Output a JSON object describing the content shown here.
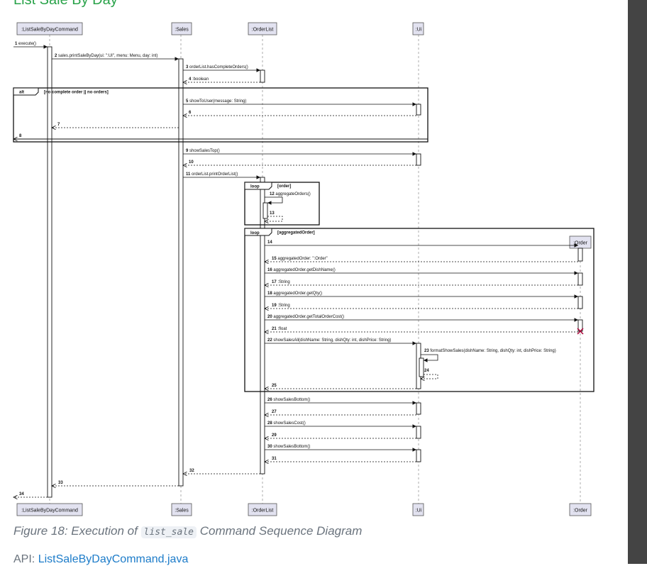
{
  "heading": "List Sale By Day",
  "participants": {
    "listSaleByDayCommand": ":ListSaleByDayCommand",
    "sales": ":Sales",
    "orderList": ":OrderList",
    "ui": ":Ui",
    "order": ":Order"
  },
  "fragments": {
    "alt_label": "alt",
    "alt_guard": "[no complete order || no orders]",
    "loop1_label": "loop",
    "loop1_guard": "[order]",
    "loop2_label": "loop",
    "loop2_guard": "[aggregatedOrder]"
  },
  "messages": [
    {
      "num": "1",
      "text": "execute()"
    },
    {
      "num": "2",
      "text": "sales.printSaleByDay(ui: \":UI\", menu: Menu, day: int)"
    },
    {
      "num": "3",
      "text": "orderList.hasCompleteOrders()"
    },
    {
      "num": "4",
      "text": ":boolean"
    },
    {
      "num": "5",
      "text": "showToUser(message: String)"
    },
    {
      "num": "6",
      "text": ""
    },
    {
      "num": "7",
      "text": ""
    },
    {
      "num": "8",
      "text": ""
    },
    {
      "num": "9",
      "text": "showSalesTop()"
    },
    {
      "num": "10",
      "text": ""
    },
    {
      "num": "11",
      "text": "orderList.printOrderList()"
    },
    {
      "num": "12",
      "text": "aggregateOrders()"
    },
    {
      "num": "13",
      "text": ""
    },
    {
      "num": "14",
      "text": ""
    },
    {
      "num": "15",
      "text": "aggregatedOrder: \":Order\""
    },
    {
      "num": "16",
      "text": "aggregatedOrder.getDishName()"
    },
    {
      "num": "17",
      "text": ":String"
    },
    {
      "num": "18",
      "text": "aggregatedOrder.getQty()"
    },
    {
      "num": "19",
      "text": ":String"
    },
    {
      "num": "20",
      "text": "aggregatedOrder.getTotalOrderCost()"
    },
    {
      "num": "21",
      "text": ":float"
    },
    {
      "num": "22",
      "text": "showSalesAll(dishName: String, dishQty: int, dishPrice: String)"
    },
    {
      "num": "23",
      "text": "formatShowSales(dishName: String, dishQty: int, dishPrice: String)"
    },
    {
      "num": "24",
      "text": ""
    },
    {
      "num": "25",
      "text": ""
    },
    {
      "num": "26",
      "text": "showSalesBottom()"
    },
    {
      "num": "27",
      "text": ""
    },
    {
      "num": "28",
      "text": "showSalesCost()"
    },
    {
      "num": "29",
      "text": ""
    },
    {
      "num": "30",
      "text": "showSalesBottom()"
    },
    {
      "num": "31",
      "text": ""
    },
    {
      "num": "32",
      "text": ""
    },
    {
      "num": "33",
      "text": ""
    },
    {
      "num": "34",
      "text": ""
    }
  ],
  "caption": {
    "prefix": "Figure 18: Execution of ",
    "code": "list_sale",
    "suffix": " Command Sequence Diagram"
  },
  "api": {
    "label": "API: ",
    "link_text": "ListSaleByDayCommand.java"
  },
  "colors": {
    "heading": "#2aa34a",
    "participant_fill": "#e2e2f0",
    "link": "#1d7cc9",
    "sidebar": "#444444",
    "destroy_mark": "#a80036"
  }
}
